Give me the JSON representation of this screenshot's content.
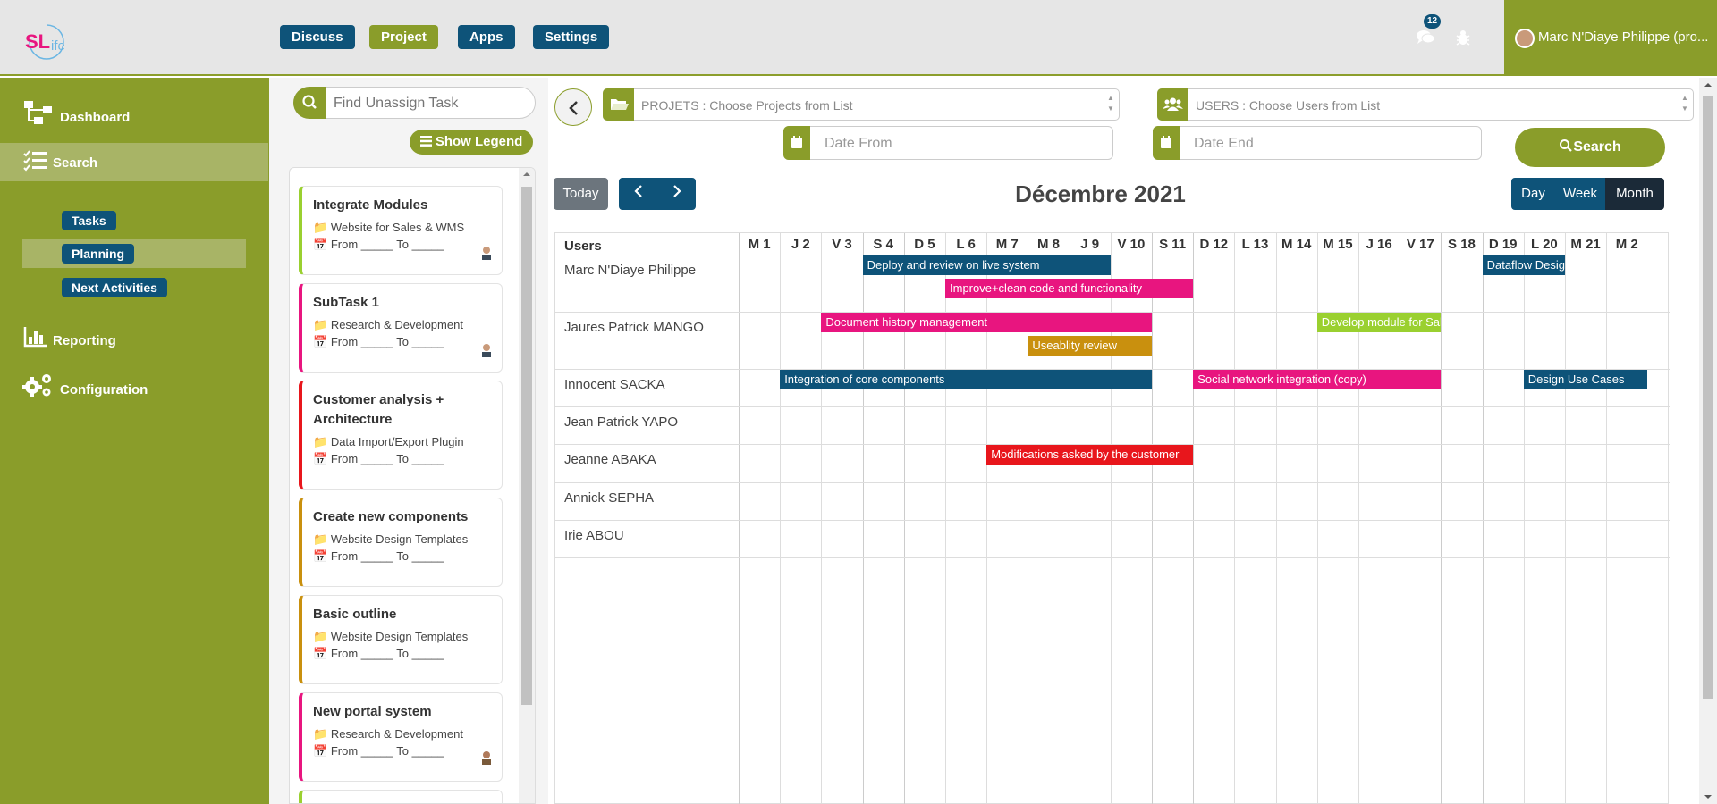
{
  "header": {
    "logo_text": "SLife",
    "nav": [
      "Discuss",
      "Project",
      "Apps",
      "Settings"
    ],
    "notification_count": "12",
    "user_name": "Marc N'Diaye Philippe (pro..."
  },
  "sidebar": {
    "items": [
      {
        "label": "Dashboard",
        "icon": "sitemap-icon"
      },
      {
        "label": "Search",
        "icon": "list-icon",
        "active": true
      },
      {
        "label": "Reporting",
        "icon": "bar-chart-icon"
      },
      {
        "label": "Configuration",
        "icon": "gears-icon"
      }
    ],
    "subitems": [
      {
        "label": "Tasks"
      },
      {
        "label": "Planning",
        "active": true
      },
      {
        "label": "Next Activities"
      }
    ]
  },
  "tasks_panel": {
    "search_placeholder": "Find Unassign Task",
    "legend_label": "Show Legend",
    "from_to": "From _____ To _____",
    "tasks": [
      {
        "title": "Integrate Modules",
        "project": "Website for Sales & WMS",
        "color": "#9ad030"
      },
      {
        "title": "SubTask 1",
        "project": "Research & Development",
        "color": "#e8157f"
      },
      {
        "title": "Customer analysis + Architecture",
        "project": "Data Import/Export Plugin",
        "color": "#e8161c"
      },
      {
        "title": "Create new components",
        "project": "Website Design Templates",
        "color": "#c9900e"
      },
      {
        "title": "Basic outline",
        "project": "Website Design Templates",
        "color": "#c9900e"
      },
      {
        "title": "New portal system",
        "project": "Research & Development",
        "color": "#e8157f"
      }
    ]
  },
  "filters": {
    "projects_placeholder": "PROJETS : Choose Projects from List",
    "users_placeholder": "USERS : Choose Users from List",
    "date_from_placeholder": "Date From",
    "date_end_placeholder": "Date End",
    "search_label": "Search"
  },
  "calendar": {
    "today_label": "Today",
    "title": "Décembre 2021",
    "views": [
      "Day",
      "Week",
      "Month"
    ],
    "active_view": "Month",
    "users_header": "Users",
    "days": [
      "M 1",
      "J 2",
      "V 3",
      "S 4",
      "D 5",
      "L 6",
      "M 7",
      "M 8",
      "J 9",
      "V 10",
      "S 11",
      "D 12",
      "L 13",
      "M 14",
      "M 15",
      "J 16",
      "V 17",
      "S 18",
      "D 19",
      "L 20",
      "M 21",
      "M 2"
    ],
    "users": [
      "Marc N'Diaye Philippe",
      "Jaures Patrick MANGO",
      "Innocent SACKA",
      "Jean Patrick YAPO",
      "Jeanne ABAKA",
      "Annick SEPHA",
      "Irie ABOU"
    ],
    "events": [
      {
        "user": 0,
        "lane": 0,
        "start": 3,
        "end": 9,
        "label": "Deploy and review on live system",
        "color": "#0e5379"
      },
      {
        "user": 0,
        "lane": 1,
        "start": 5,
        "end": 11,
        "label": "Improve+clean code and functionality",
        "color": "#e8157f"
      },
      {
        "user": 0,
        "lane": 0,
        "start": 18,
        "end": 20,
        "label": "Dataflow Design",
        "color": "#0e5379"
      },
      {
        "user": 1,
        "lane": 0,
        "start": 2,
        "end": 10,
        "label": "Document history management",
        "color": "#e8157f"
      },
      {
        "user": 1,
        "lane": 1,
        "start": 7,
        "end": 10,
        "label": "Useablity review",
        "color": "#c9900e"
      },
      {
        "user": 1,
        "lane": 0,
        "start": 14,
        "end": 17,
        "label": "Develop module for Sales",
        "color": "#9ad030"
      },
      {
        "user": 2,
        "lane": 0,
        "start": 1,
        "end": 10,
        "label": "Integration of core components",
        "color": "#0e5379"
      },
      {
        "user": 2,
        "lane": 0,
        "start": 11,
        "end": 17,
        "label": "Social network integration (copy)",
        "color": "#e8157f"
      },
      {
        "user": 2,
        "lane": 0,
        "start": 19,
        "end": 22,
        "label": "Design Use Cases",
        "color": "#0e5379"
      },
      {
        "user": 4,
        "lane": 0,
        "start": 6,
        "end": 11,
        "label": "Modifications asked by the customer",
        "color": "#e8161c"
      }
    ]
  },
  "colors": {
    "brand_green": "#8a9d2a",
    "brand_blue": "#0e5379",
    "today_grey": "#6c757d",
    "active_view": "#1b2a38"
  }
}
